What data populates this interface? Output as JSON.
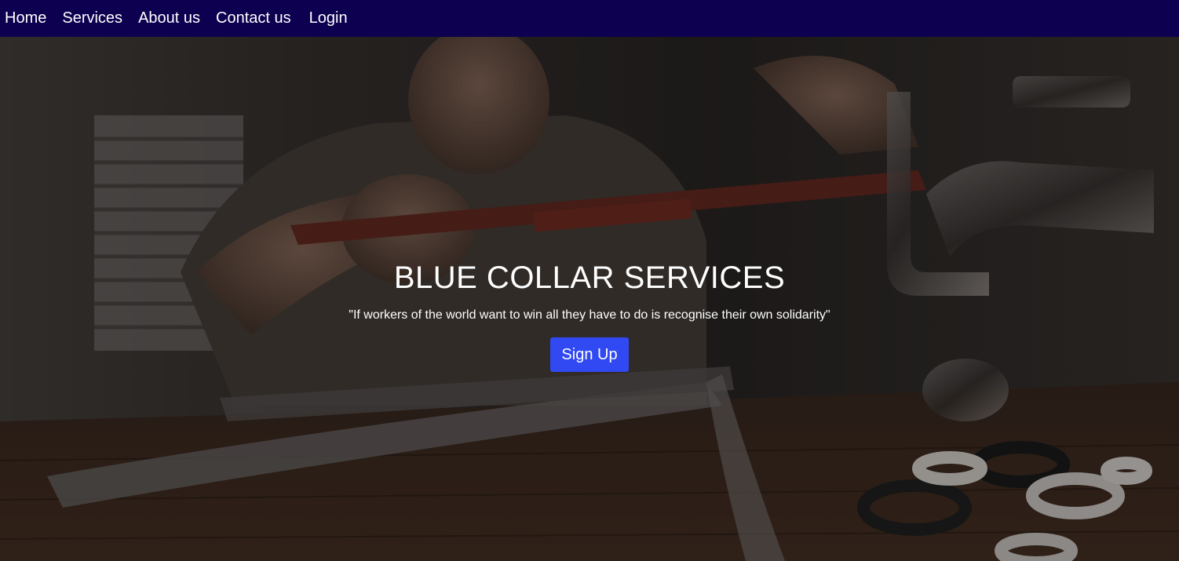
{
  "nav": {
    "items": [
      {
        "label": "Home"
      },
      {
        "label": "Services"
      },
      {
        "label": "About us"
      },
      {
        "label": "Contact us"
      },
      {
        "label": "Login"
      }
    ]
  },
  "hero": {
    "title": "BLUE COLLAR SERVICES",
    "quote": "\"If workers of the world want to win all they have to do is recognise their own solidarity\"",
    "button_label": "Sign Up",
    "image_icon": "plumber-photo"
  },
  "colors": {
    "navbar": "#0d0050",
    "button": "#3049f2",
    "text": "#ffffff"
  }
}
